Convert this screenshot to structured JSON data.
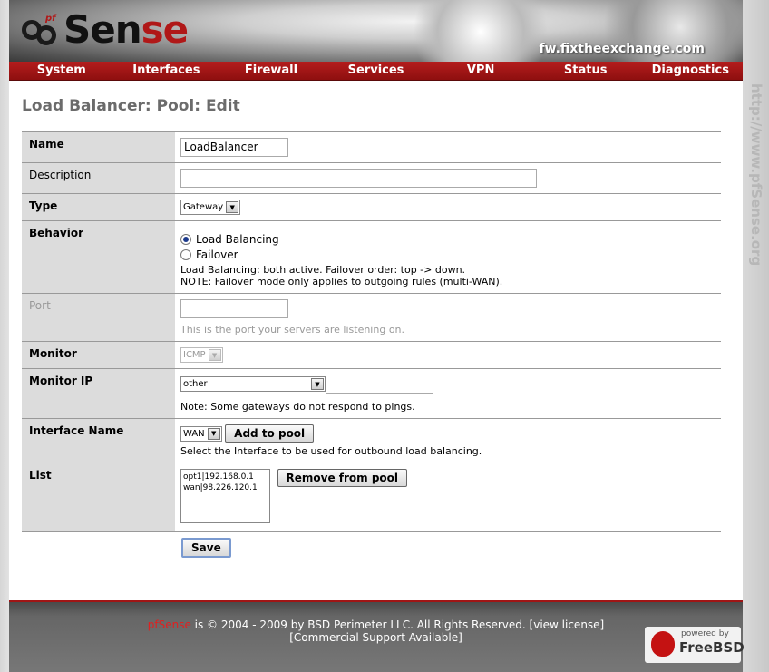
{
  "header": {
    "logo_pf": "pf",
    "logo_main": "Sen",
    "logo_red": "se",
    "hostname": "fw.fixtheexchange.com",
    "side_url": "http://www.pfSense.org"
  },
  "nav": [
    "System",
    "Interfaces",
    "Firewall",
    "Services",
    "VPN",
    "Status",
    "Diagnostics"
  ],
  "page_title": "Load Balancer: Pool: Edit",
  "form": {
    "name": {
      "label": "Name",
      "value": "LoadBalancer"
    },
    "description": {
      "label": "Description",
      "value": ""
    },
    "type": {
      "label": "Type",
      "selected": "Gateway"
    },
    "behavior": {
      "label": "Behavior",
      "option1": "Load Balancing",
      "option2": "Failover",
      "note1": "Load Balancing: both active. Failover order: top -> down.",
      "note2": "NOTE: Failover mode only applies to outgoing rules (multi-WAN)."
    },
    "port": {
      "label": "Port",
      "value": "",
      "hint": "This is the port your servers are listening on."
    },
    "monitor": {
      "label": "Monitor",
      "selected": "ICMP"
    },
    "monitor_ip": {
      "label": "Monitor IP",
      "selected": "other",
      "value": "",
      "note": "Note: Some gateways do not respond to pings."
    },
    "interface_name": {
      "label": "Interface Name",
      "selected": "WAN",
      "add_button": "Add to pool",
      "hint": "Select the Interface to be used for outbound load balancing."
    },
    "list": {
      "label": "List",
      "items": [
        "opt1|192.168.0.1",
        "wan|98.226.120.1"
      ],
      "remove_button": "Remove from pool"
    },
    "save_button": "Save"
  },
  "footer": {
    "brand": "pfSense",
    "copyright": " is © 2004 - 2009 by BSD Perimeter LLC. All Rights Reserved. [view license]",
    "support": "[Commercial Support Available]",
    "powered_by": "powered by",
    "freebsd": "FreeBSD"
  },
  "colors": {
    "nav_red": "#a31818",
    "label_bg": "#dcdcdc",
    "title_gray": "#6b6b6b"
  }
}
